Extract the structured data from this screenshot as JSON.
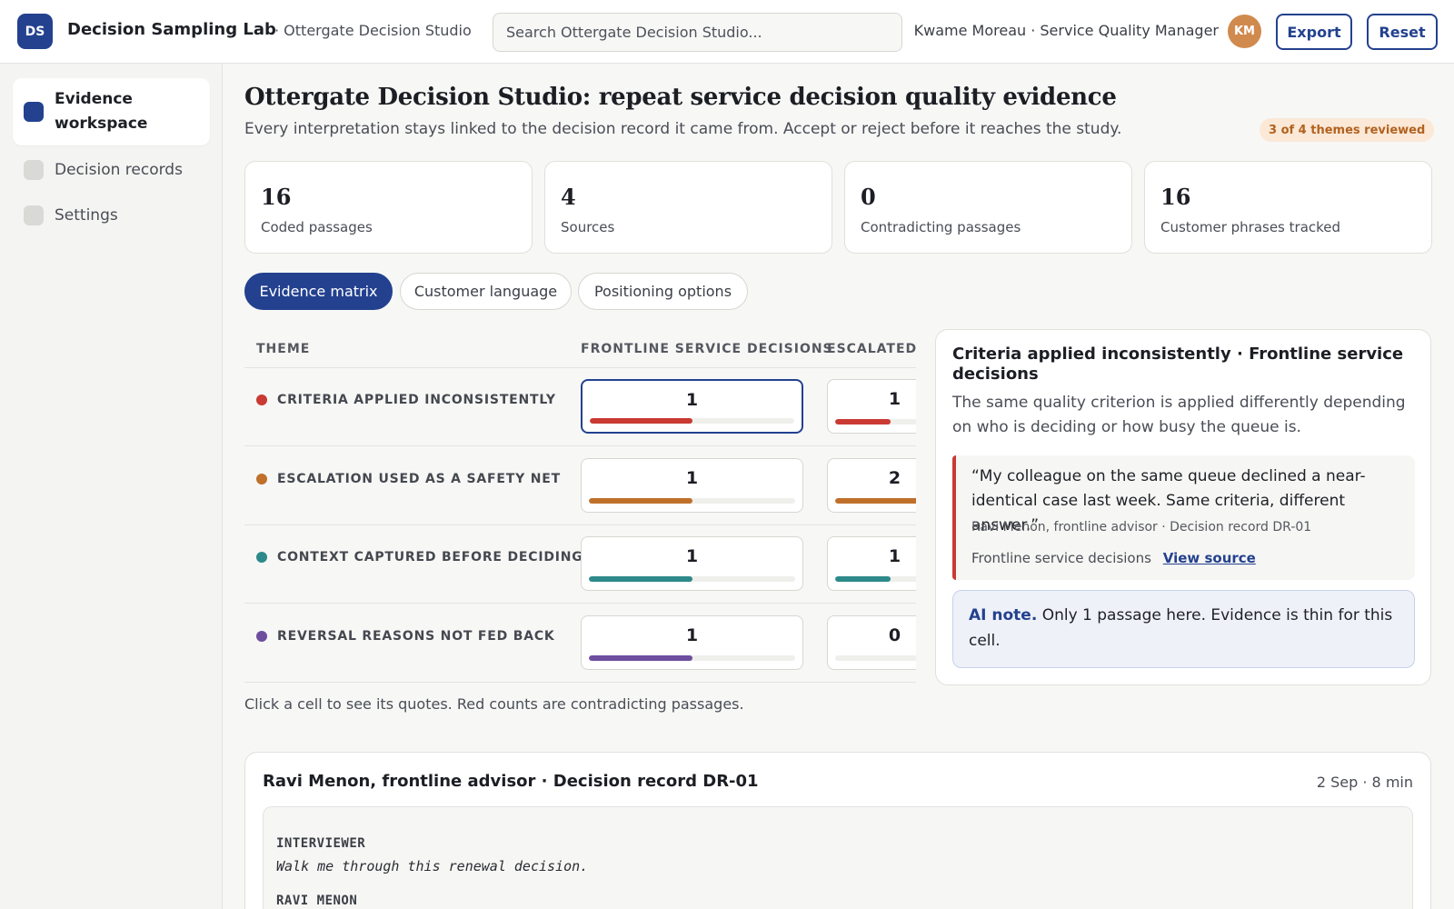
{
  "app": {
    "logo": "DS",
    "title": "Decision Sampling Lab",
    "workspace": "· Ottergate Decision Studio",
    "search_placeholder": "Search Ottergate Decision Studio...",
    "user": "Kwame Moreau · Service Quality Manager",
    "avatar": "KM",
    "export_label": "Export",
    "reset_label": "Reset"
  },
  "sidebar": {
    "items": [
      {
        "label": "Evidence workspace",
        "active": true,
        "icon": "square-icon"
      },
      {
        "label": "Decision records",
        "active": false,
        "icon": "square-icon"
      },
      {
        "label": "Settings",
        "active": false,
        "icon": "square-icon"
      }
    ]
  },
  "page": {
    "title": "Ottergate Decision Studio: repeat service decision quality evidence",
    "subtitle": "Every interpretation stays linked to the decision record it came from. Accept or reject before it reaches the study.",
    "review_badge": "3 of 4 themes reviewed"
  },
  "stats": [
    {
      "value": "16",
      "label": "Coded passages"
    },
    {
      "value": "4",
      "label": "Sources"
    },
    {
      "value": "0",
      "label": "Contradicting passages"
    },
    {
      "value": "16",
      "label": "Customer phrases tracked"
    }
  ],
  "tabs": [
    {
      "label": "Evidence matrix",
      "active": true
    },
    {
      "label": "Customer language",
      "active": false
    },
    {
      "label": "Positioning options",
      "active": false
    }
  ],
  "matrix": {
    "columns": [
      "THEME",
      "FRONTLINE SERVICE DECISIONS",
      "ESCALATED C"
    ],
    "max_count": 2,
    "rows": [
      {
        "theme": "CRITERIA APPLIED INCONSISTENTLY",
        "color": "#c93a33",
        "counts": [
          1,
          1
        ]
      },
      {
        "theme": "ESCALATION USED AS A SAFETY NET",
        "color": "#c0702a",
        "counts": [
          1,
          2
        ]
      },
      {
        "theme": "CONTEXT CAPTURED BEFORE DECIDING",
        "color": "#2e8a8a",
        "counts": [
          1,
          1
        ]
      },
      {
        "theme": "REVERSAL REASONS NOT FED BACK",
        "color": "#6e4e9e",
        "counts": [
          1,
          0
        ]
      }
    ],
    "hint": "Click a cell to see its quotes. Red counts are contradicting passages."
  },
  "detail": {
    "title": "Criteria applied inconsistently · Frontline service decisions",
    "description": "The same quality criterion is applied differently depending on who is deciding or how busy the queue is.",
    "quote": "“My colleague on the same queue declined a near-identical case last week. Same criteria, different answer.”",
    "quote_meta": "Ravi Menon, frontline advisor · Decision record DR-01",
    "quote_source": "Frontline service decisions",
    "view_source_label": "View source",
    "ai_label": "AI note.",
    "ai_text": " Only 1 passage here. Evidence is thin for this cell."
  },
  "transcript": {
    "title": "Ravi Menon, frontline advisor · Decision record DR-01",
    "meta": "2 Sep · 8 min",
    "lines": [
      {
        "speaker": "INTERVIEWER",
        "text": "Walk me through this renewal decision."
      },
      {
        "speaker": "RAVI MENON",
        "text": ""
      }
    ]
  }
}
